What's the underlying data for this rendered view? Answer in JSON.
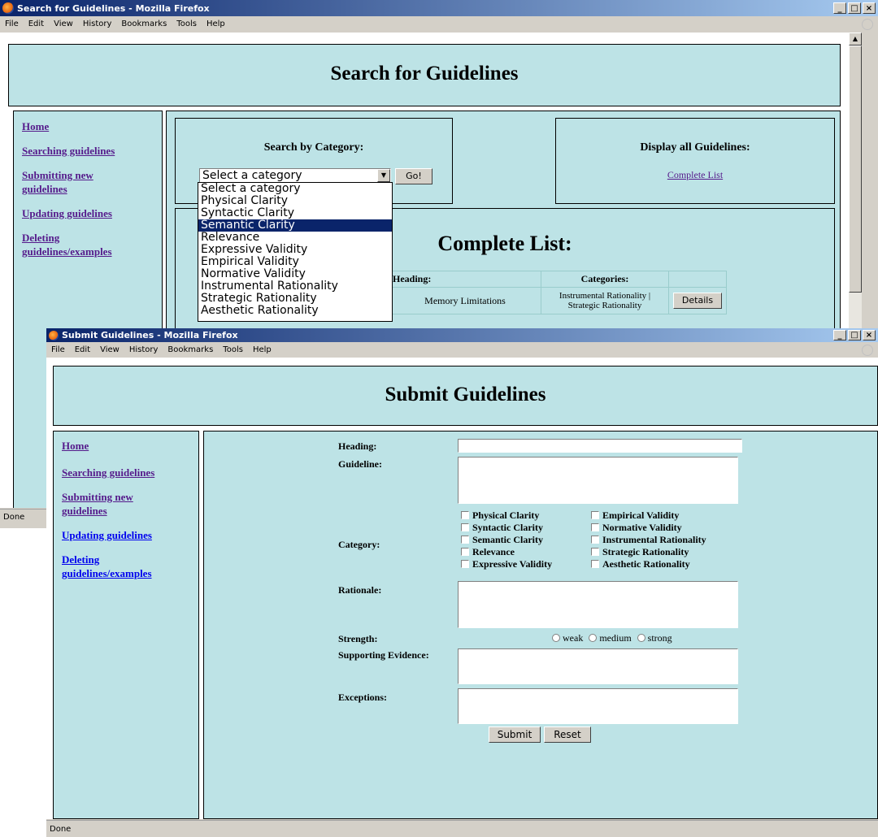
{
  "window_back": {
    "title": "Search for Guidelines - Mozilla Firefox",
    "menu": [
      "File",
      "Edit",
      "View",
      "History",
      "Bookmarks",
      "Tools",
      "Help"
    ],
    "page_title": "Search for Guidelines",
    "nav": [
      "Home",
      "Searching guidelines",
      "Submitting new guidelines",
      "Updating guidelines",
      "Deleting guidelines/examples"
    ],
    "search_by_category": "Search by Category:",
    "select_value": "Select a category",
    "go_label": "Go!",
    "display_all": "Display all Guidelines:",
    "complete_list_link": "Complete List",
    "complete_list_heading": "Complete List:",
    "dropdown_options": [
      "Select a category",
      "Physical Clarity",
      "Syntactic Clarity",
      "Semantic Clarity",
      "Relevance",
      "Expressive Validity",
      "Empirical Validity",
      "Normative Validity",
      "Instrumental Rationality",
      "Strategic Rationality",
      "Aesthetic Rationality"
    ],
    "dropdown_selected": "Semantic Clarity",
    "table_headers": [
      "Heading:",
      "Categories:",
      ""
    ],
    "table_row_heading": "Memory Limitations",
    "table_row_categories": "Instrumental Rationality | Strategic Rationality",
    "details_label": "Details",
    "status": "Done"
  },
  "window_front": {
    "title": "Submit Guidelines - Mozilla Firefox",
    "menu": [
      "File",
      "Edit",
      "View",
      "History",
      "Bookmarks",
      "Tools",
      "Help"
    ],
    "page_title": "Submit Guidelines",
    "nav": [
      "Home",
      "Searching guidelines",
      "Submitting new guidelines",
      "Updating guidelines",
      "Deleting guidelines/examples"
    ],
    "labels": {
      "heading": "Heading:",
      "guideline": "Guideline:",
      "category": "Category:",
      "rationale": "Rationale:",
      "strength": "Strength:",
      "supporting_evidence": "Supporting Evidence:",
      "exceptions": "Exceptions:"
    },
    "categories_left": [
      "Physical Clarity",
      "Syntactic Clarity",
      "Semantic Clarity",
      "Relevance",
      "Expressive Validity"
    ],
    "categories_right": [
      "Empirical Validity",
      "Normative Validity",
      "Instrumental Rationality",
      "Strategic Rationality",
      "Aesthetic Rationality"
    ],
    "strength_options": [
      "weak",
      "medium",
      "strong"
    ],
    "submit_label": "Submit",
    "reset_label": "Reset",
    "status": "Done"
  },
  "window_buttons": [
    "_",
    "□",
    "×"
  ]
}
